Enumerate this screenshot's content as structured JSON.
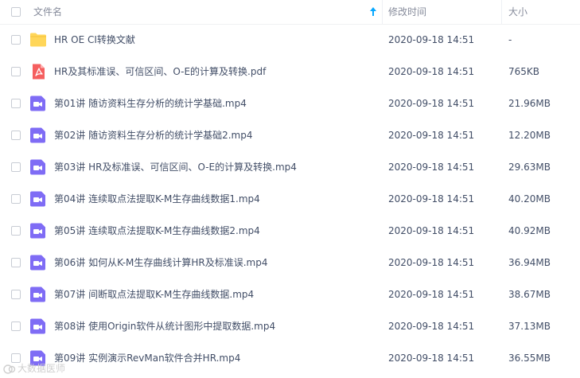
{
  "header": {
    "col_name": "文件名",
    "col_modified": "修改时间",
    "col_size": "大小"
  },
  "colors": {
    "text": "#424e67",
    "header_text": "#878c9c",
    "folder": "#ffd659",
    "pdf": "#f55f5f",
    "video": "#7f6cf5",
    "sort_arrow": "#06a7ff"
  },
  "files": [
    {
      "name": "HR OE CI转换文献",
      "modified": "2020-09-18 14:51",
      "size": "-",
      "icon": "folder-icon"
    },
    {
      "name": "HR及其标准误、可信区间、O-E的计算及转换.pdf",
      "modified": "2020-09-18 14:51",
      "size": "765KB",
      "icon": "pdf-icon"
    },
    {
      "name": "第01讲 随访资料生存分析的统计学基础.mp4",
      "modified": "2020-09-18 14:51",
      "size": "21.96MB",
      "icon": "video-icon"
    },
    {
      "name": "第02讲 随访资料生存分析的统计学基础2.mp4",
      "modified": "2020-09-18 14:51",
      "size": "12.20MB",
      "icon": "video-icon"
    },
    {
      "name": "第03讲 HR及标准误、可信区间、O-E的计算及转换.mp4",
      "modified": "2020-09-18 14:51",
      "size": "29.63MB",
      "icon": "video-icon"
    },
    {
      "name": "第04讲 连续取点法提取K-M生存曲线数据1.mp4",
      "modified": "2020-09-18 14:51",
      "size": "40.20MB",
      "icon": "video-icon"
    },
    {
      "name": "第05讲 连续取点法提取K-M生存曲线数据2.mp4",
      "modified": "2020-09-18 14:51",
      "size": "40.92MB",
      "icon": "video-icon"
    },
    {
      "name": "第06讲 如何从K-M生存曲线计算HR及标准误.mp4",
      "modified": "2020-09-18 14:51",
      "size": "36.94MB",
      "icon": "video-icon"
    },
    {
      "name": "第07讲 间断取点法提取K-M生存曲线数据.mp4",
      "modified": "2020-09-18 14:51",
      "size": "38.67MB",
      "icon": "video-icon"
    },
    {
      "name": "第08讲 使用Origin软件从统计图形中提取数据.mp4",
      "modified": "2020-09-18 14:51",
      "size": "37.13MB",
      "icon": "video-icon"
    },
    {
      "name": "第09讲 实例演示RevMan软件合并HR.mp4",
      "modified": "2020-09-18 14:51",
      "size": "36.55MB",
      "icon": "video-icon"
    }
  ],
  "watermark": "大数据医师"
}
